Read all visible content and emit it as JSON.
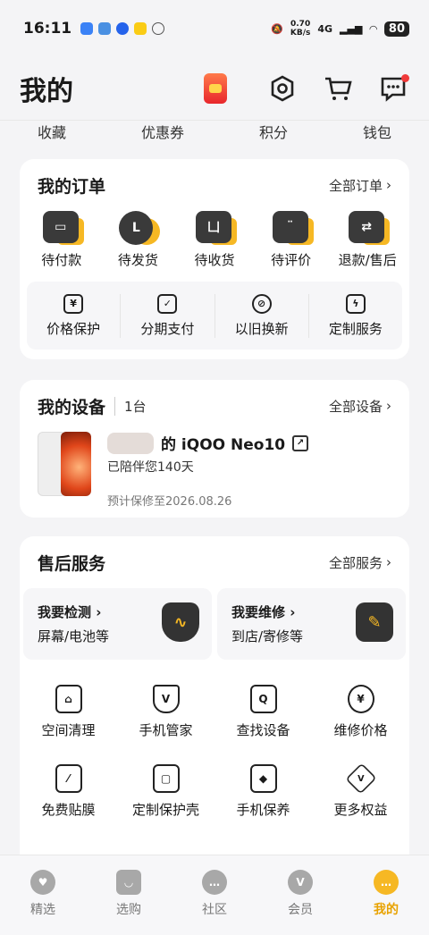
{
  "status": {
    "time": "16:11",
    "net_speed_value": "0.70",
    "net_speed_unit": "KB/s",
    "signal": "4G",
    "battery": "80"
  },
  "header": {
    "title": "我的"
  },
  "quick": [
    "收藏",
    "优惠券",
    "积分",
    "钱包"
  ],
  "orders": {
    "title": "我的订单",
    "link": "全部订单",
    "items": [
      {
        "label": "待付款",
        "glyph": "▭"
      },
      {
        "label": "待发货",
        "glyph": "L"
      },
      {
        "label": "待收货",
        "glyph": "凵"
      },
      {
        "label": "待评价",
        "glyph": "¨"
      },
      {
        "label": "退款/售后",
        "glyph": "⇄"
      }
    ],
    "services": [
      {
        "label": "价格保护",
        "glyph": "¥"
      },
      {
        "label": "分期支付",
        "glyph": "✓"
      },
      {
        "label": "以旧换新",
        "glyph": "⊘"
      },
      {
        "label": "定制服务",
        "glyph": "ϟ"
      }
    ]
  },
  "devices": {
    "title": "我的设备",
    "count": "1台",
    "link": "全部设备",
    "name": "的 iQOO Neo10",
    "days": "已陪伴您140天",
    "warranty": "预计保修至2026.08.26"
  },
  "after_sales": {
    "title": "售后服务",
    "link": "全部服务",
    "detect_title": "我要检测",
    "detect_sub": "屏幕/电池等",
    "repair_title": "我要维修",
    "repair_sub": "到店/寄修等",
    "grid": [
      {
        "label": "空间清理",
        "glyph": "⌂"
      },
      {
        "label": "手机管家",
        "glyph": "V"
      },
      {
        "label": "查找设备",
        "glyph": "Q"
      },
      {
        "label": "维修价格",
        "glyph": "¥"
      },
      {
        "label": "免费贴膜",
        "glyph": "⁄"
      },
      {
        "label": "定制保护壳",
        "glyph": "▢"
      },
      {
        "label": "手机保养",
        "glyph": "◆"
      },
      {
        "label": "更多权益",
        "glyph": "V"
      }
    ]
  },
  "tabs": [
    {
      "label": "精选",
      "glyph": "♥"
    },
    {
      "label": "选购",
      "glyph": "◡"
    },
    {
      "label": "社区",
      "glyph": "…"
    },
    {
      "label": "会员",
      "glyph": "V"
    },
    {
      "label": "我的",
      "glyph": "…"
    }
  ],
  "colors": {
    "accent": "#f6b824",
    "dark_icon": "#3a3a3a",
    "badge_red": "#f03a3a"
  }
}
